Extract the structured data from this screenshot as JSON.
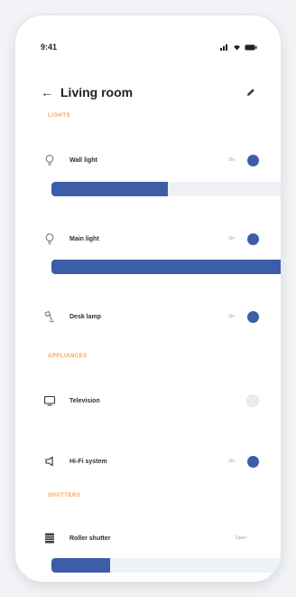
{
  "status_bar": {
    "time": "9:41"
  },
  "header": {
    "title": "Living room"
  },
  "sections": {
    "lights": "Lights",
    "appliances": "Appliances",
    "shutters": "Shutters"
  },
  "devices": {
    "wall_light": {
      "label": "Wall light",
      "status": "On",
      "on": true,
      "level": 0.5
    },
    "main_light": {
      "label": "Main light",
      "status": "On",
      "on": true,
      "level": 1.0
    },
    "desk_lamp": {
      "label": "Desk lamp",
      "status": "On",
      "on": true
    },
    "television": {
      "label": "Television",
      "status": "",
      "on": false
    },
    "hifi_system": {
      "label": "Hi-Fi system",
      "status": "On",
      "on": true
    },
    "roller_shutter": {
      "label": "Roller shutter",
      "status": "Open",
      "level": 0.25
    }
  },
  "colors": {
    "accent": "#3c5da8",
    "section": "#f0a15a"
  }
}
